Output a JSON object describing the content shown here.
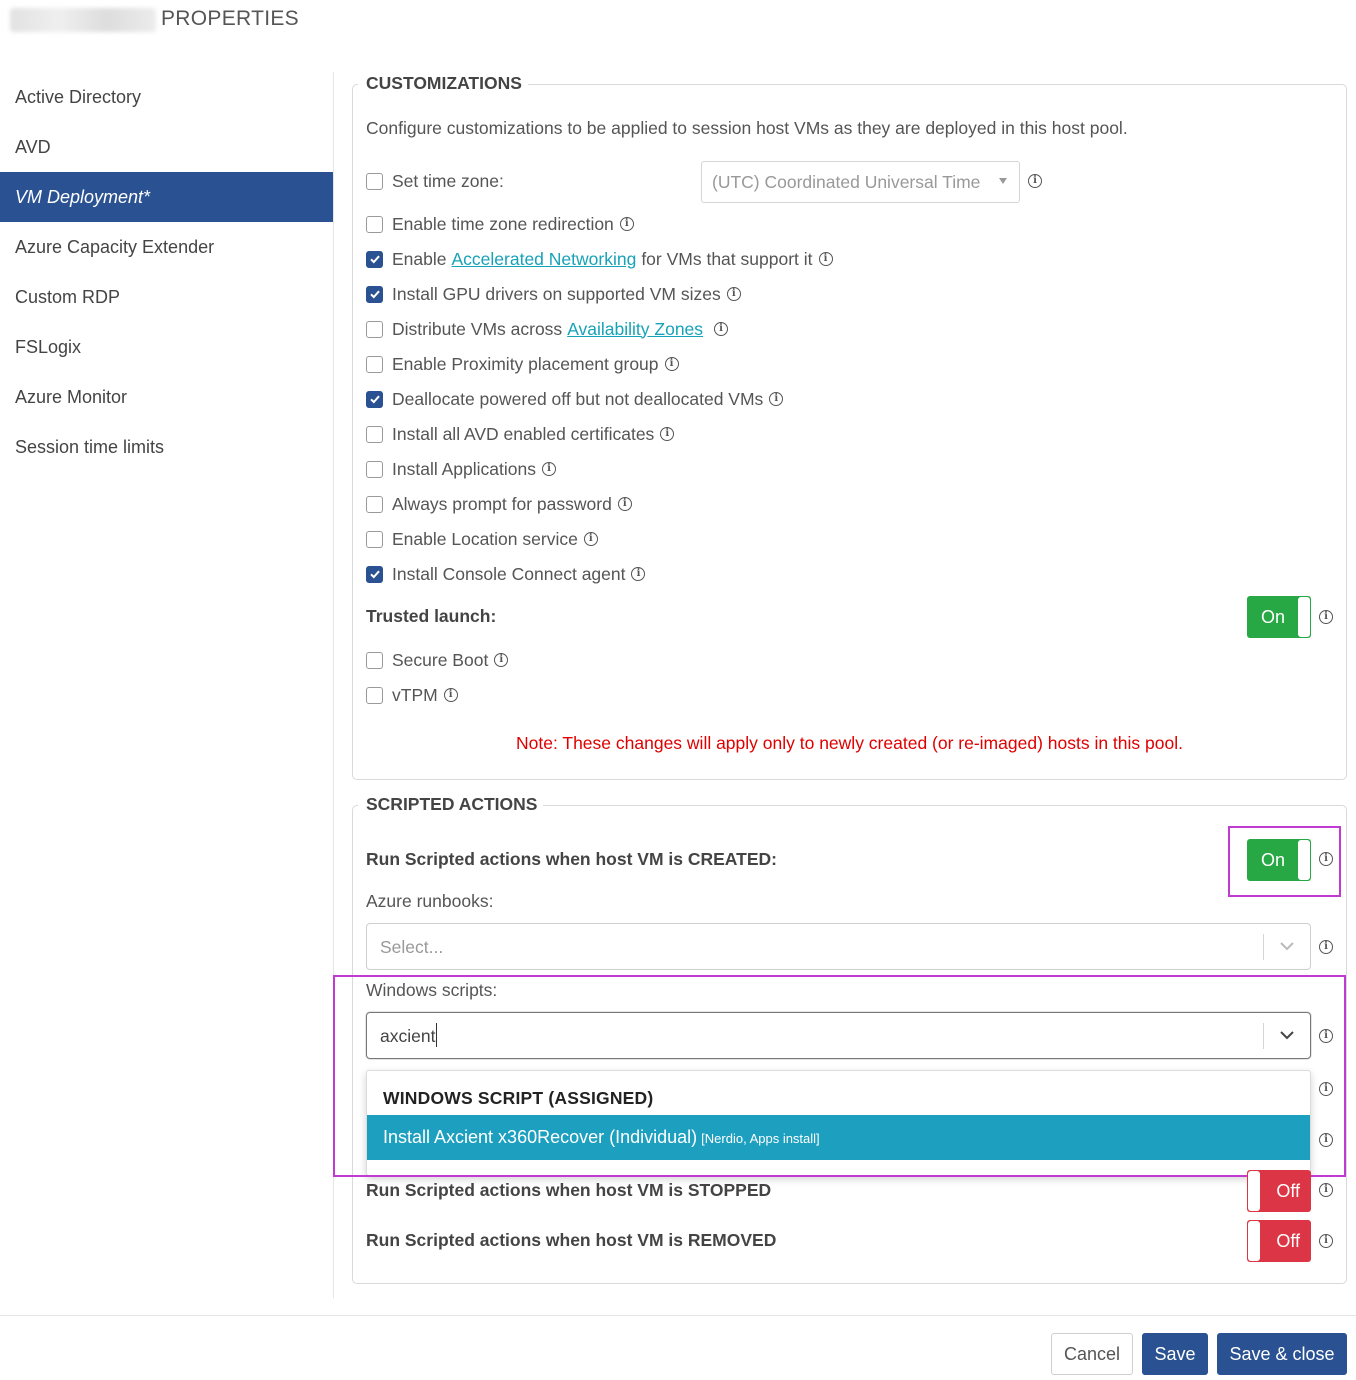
{
  "header": {
    "title_suffix": "PROPERTIES"
  },
  "sidebar": {
    "items": [
      {
        "label": "Active Directory",
        "active": false
      },
      {
        "label": "AVD",
        "active": false
      },
      {
        "label": "VM Deployment*",
        "active": true
      },
      {
        "label": "Azure Capacity Extender",
        "active": false
      },
      {
        "label": "Custom RDP",
        "active": false
      },
      {
        "label": "FSLogix",
        "active": false
      },
      {
        "label": "Azure Monitor",
        "active": false
      },
      {
        "label": "Session time limits",
        "active": false
      }
    ]
  },
  "customizations": {
    "legend": "CUSTOMIZATIONS",
    "description": "Configure customizations to be applied to session host VMs as they are deployed in this host pool.",
    "timezone": {
      "label": "Set time zone:",
      "checked": false,
      "value": "(UTC) Coordinated Universal Time"
    },
    "options": [
      {
        "text": "Enable time zone redirection",
        "checked": false
      },
      {
        "pre": "Enable",
        "link": "Accelerated Networking",
        "post": "for VMs that support it",
        "checked": true
      },
      {
        "text": "Install GPU drivers on supported VM sizes",
        "checked": true
      },
      {
        "pre": "Distribute VMs across",
        "link": "Availability Zones",
        "post": "",
        "checked": false
      },
      {
        "text": "Enable Proximity placement group",
        "checked": false
      },
      {
        "text": "Deallocate powered off but not deallocated VMs",
        "checked": true
      },
      {
        "text": "Install all AVD enabled certificates",
        "checked": false
      },
      {
        "text": "Install Applications",
        "checked": false
      },
      {
        "text": "Always prompt for password",
        "checked": false
      },
      {
        "text": "Enable Location service",
        "checked": false
      },
      {
        "text": "Install Console Connect agent",
        "checked": true
      }
    ],
    "trusted_launch": {
      "label": "Trusted launch:",
      "toggle": "On",
      "secure_boot": {
        "text": "Secure Boot",
        "checked": false
      },
      "vtpm": {
        "text": "vTPM",
        "checked": false
      }
    },
    "note": "Note: These changes will apply only to newly created (or re-imaged) hosts in this pool."
  },
  "scripted_actions": {
    "legend": "SCRIPTED ACTIONS",
    "created": {
      "label": "Run Scripted actions when host VM is CREATED:",
      "toggle": "On"
    },
    "azure_runbooks": {
      "label": "Azure runbooks:",
      "placeholder": "Select..."
    },
    "windows_scripts": {
      "label": "Windows scripts:",
      "value": "axcient"
    },
    "dropdown": {
      "group": "WINDOWS SCRIPT (ASSIGNED)",
      "option": {
        "name": "Install Axcient x360Recover (Individual)",
        "tags": "[Nerdio, Apps install]"
      }
    },
    "stopped": {
      "label": "Run Scripted actions when host VM is STOPPED",
      "toggle": "Off"
    },
    "removed": {
      "label": "Run Scripted actions when host VM is REMOVED",
      "toggle": "Off"
    }
  },
  "footer": {
    "cancel": "Cancel",
    "save": "Save",
    "save_close": "Save & close"
  },
  "colors": {
    "brand": "#2a5191",
    "toggle_on": "#28a745",
    "toggle_off": "#dc3545",
    "highlight": "#c13ad1",
    "option_bg": "#1d9fbf",
    "note": "#e00000",
    "link": "#17a2b8"
  }
}
